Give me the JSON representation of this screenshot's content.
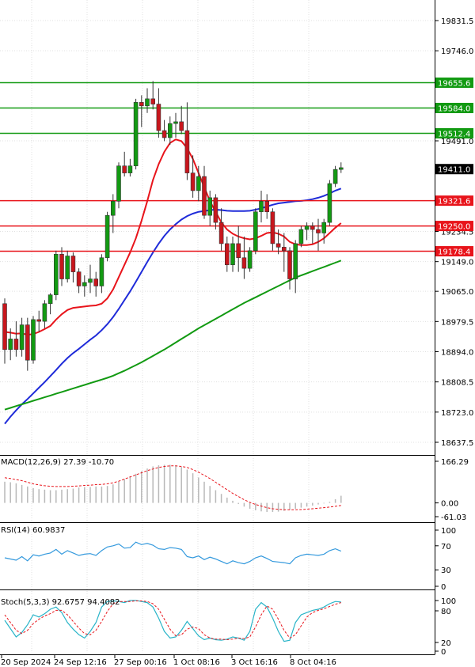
{
  "chart_data": {
    "type": "candlestick",
    "price_axis": {
      "ticks": [
        "19831.5",
        "19746.0",
        "19491.0",
        "19234.5",
        "19149.0",
        "19065.0",
        "18979.5",
        "18894.0",
        "18808.5",
        "18723.0",
        "18637.5"
      ],
      "tick_values": [
        19831.5,
        19746.0,
        19491.0,
        19234.5,
        19149.0,
        19065.0,
        18979.5,
        18894.0,
        18808.5,
        18723.0,
        18637.5
      ],
      "range": [
        18600,
        19900
      ]
    },
    "current_price": {
      "label": "19411.0",
      "value": 19411.0
    },
    "resistance_levels": [
      {
        "label": "19655.6",
        "value": 19655.6
      },
      {
        "label": "19584.0",
        "value": 19584.0
      },
      {
        "label": "19512.4",
        "value": 19512.4
      }
    ],
    "support_levels": [
      {
        "label": "19321.6",
        "value": 19321.6
      },
      {
        "label": "19250.0",
        "value": 19250.0
      },
      {
        "label": "19178.4",
        "value": 19178.4
      }
    ],
    "candles": [
      [
        19030,
        19045,
        18860,
        18900
      ],
      [
        18900,
        18960,
        18870,
        18930
      ],
      [
        18930,
        18980,
        18880,
        18900
      ],
      [
        18900,
        18990,
        18880,
        18970
      ],
      [
        18970,
        18990,
        18840,
        18870
      ],
      [
        18870,
        18995,
        18860,
        18985
      ],
      [
        18985,
        19010,
        18950,
        18980
      ],
      [
        18980,
        19040,
        18960,
        19030
      ],
      [
        19030,
        19060,
        19000,
        19055
      ],
      [
        19055,
        19180,
        19040,
        19170
      ],
      [
        19170,
        19190,
        19080,
        19100
      ],
      [
        19100,
        19180,
        19090,
        19165
      ],
      [
        19165,
        19175,
        19090,
        19120
      ],
      [
        19120,
        19130,
        19060,
        19080
      ],
      [
        19080,
        19110,
        19050,
        19090
      ],
      [
        19090,
        19140,
        19060,
        19100
      ],
      [
        19100,
        19120,
        19050,
        19080
      ],
      [
        19080,
        19170,
        19060,
        19160
      ],
      [
        19160,
        19290,
        19150,
        19280
      ],
      [
        19280,
        19340,
        19230,
        19320
      ],
      [
        19320,
        19430,
        19300,
        19420
      ],
      [
        19420,
        19460,
        19390,
        19400
      ],
      [
        19400,
        19440,
        19390,
        19420
      ],
      [
        19420,
        19610,
        19410,
        19600
      ],
      [
        19600,
        19620,
        19530,
        19590
      ],
      [
        19590,
        19640,
        19570,
        19610
      ],
      [
        19610,
        19660,
        19580,
        19595
      ],
      [
        19595,
        19640,
        19500,
        19520
      ],
      [
        19520,
        19550,
        19490,
        19500
      ],
      [
        19500,
        19560,
        19480,
        19540
      ],
      [
        19540,
        19570,
        19500,
        19545
      ],
      [
        19545,
        19590,
        19510,
        19520
      ],
      [
        19520,
        19600,
        19380,
        19400
      ],
      [
        19400,
        19450,
        19330,
        19350
      ],
      [
        19350,
        19420,
        19320,
        19390
      ],
      [
        19390,
        19420,
        19270,
        19280
      ],
      [
        19280,
        19350,
        19250,
        19330
      ],
      [
        19330,
        19340,
        19240,
        19260
      ],
      [
        19260,
        19300,
        19180,
        19200
      ],
      [
        19200,
        19220,
        19120,
        19140
      ],
      [
        19140,
        19220,
        19120,
        19200
      ],
      [
        19200,
        19250,
        19120,
        19160
      ],
      [
        19160,
        19220,
        19100,
        19130
      ],
      [
        19130,
        19190,
        19120,
        19180
      ],
      [
        19180,
        19300,
        19170,
        19290
      ],
      [
        19290,
        19350,
        19260,
        19320
      ],
      [
        19320,
        19340,
        19270,
        19290
      ],
      [
        19290,
        19300,
        19180,
        19200
      ],
      [
        19200,
        19240,
        19170,
        19190
      ],
      [
        19190,
        19230,
        19120,
        19180
      ],
      [
        19180,
        19190,
        19070,
        19100
      ],
      [
        19100,
        19210,
        19060,
        19200
      ],
      [
        19200,
        19250,
        19190,
        19240
      ],
      [
        19240,
        19260,
        19210,
        19250
      ],
      [
        19250,
        19260,
        19200,
        19240
      ],
      [
        19240,
        19270,
        19180,
        19230
      ],
      [
        19230,
        19270,
        19200,
        19260
      ],
      [
        19260,
        19380,
        19250,
        19370
      ],
      [
        19370,
        19420,
        19360,
        19410
      ],
      [
        19410,
        19430,
        19400,
        19415
      ]
    ],
    "moving_averages": [
      {
        "color": "#e8141b",
        "values": [
          18950,
          18948,
          18945,
          18946,
          18942,
          18944,
          18950,
          18958,
          18967,
          18985,
          19000,
          19012,
          19018,
          19020,
          19022,
          19024,
          19025,
          19030,
          19045,
          19070,
          19105,
          19140,
          19175,
          19215,
          19265,
          19320,
          19380,
          19425,
          19460,
          19485,
          19495,
          19490,
          19470,
          19440,
          19400,
          19360,
          19320,
          19290,
          19260,
          19240,
          19228,
          19220,
          19215,
          19212,
          19215,
          19222,
          19230,
          19232,
          19228,
          19220,
          19205,
          19198,
          19196,
          19196,
          19198,
          19205,
          19215,
          19230,
          19245,
          19258
        ]
      },
      {
        "color": "#1f2bd9",
        "values": [
          18690,
          18710,
          18728,
          18745,
          18760,
          18776,
          18792,
          18808,
          18825,
          18842,
          18860,
          18876,
          18890,
          18902,
          18915,
          18928,
          18940,
          18955,
          18972,
          18992,
          19015,
          19040,
          19065,
          19092,
          19120,
          19148,
          19175,
          19200,
          19222,
          19240,
          19255,
          19268,
          19278,
          19285,
          19290,
          19292,
          19295,
          19296,
          19295,
          19293,
          19292,
          19292,
          19292,
          19293,
          19296,
          19300,
          19305,
          19310,
          19314,
          19316,
          19318,
          19320,
          19321,
          19323,
          19326,
          19330,
          19335,
          19342,
          19350,
          19356
        ]
      },
      {
        "color": "#129a12",
        "values": [
          18730,
          18735,
          18740,
          18745,
          18750,
          18755,
          18760,
          18765,
          18770,
          18775,
          18780,
          18785,
          18790,
          18795,
          18800,
          18805,
          18810,
          18815,
          18820,
          18826,
          18833,
          18840,
          18848,
          18856,
          18864,
          18873,
          18882,
          18891,
          18900,
          18910,
          18920,
          18930,
          18940,
          18950,
          18960,
          18969,
          18978,
          18987,
          18996,
          19005,
          19014,
          19023,
          19032,
          19040,
          19048,
          19056,
          19064,
          19072,
          19080,
          19088,
          19096,
          19104,
          19110,
          19116,
          19122,
          19128,
          19134,
          19140,
          19146,
          19152
        ]
      }
    ],
    "x_axis": {
      "labels": [
        "20 Sep 2024",
        "24 Sep 12:16",
        "27 Sep 00:16",
        "1 Oct 08:16",
        "3 Oct 16:16",
        "8 Oct 04:16"
      ]
    },
    "macd": {
      "label": "MACD(12,26,9) 27.39 -10.70",
      "scale_labels": [
        "166.29",
        "0.00",
        "-61.03"
      ],
      "range": [
        -61.03,
        166.29
      ],
      "histogram": [
        80,
        78,
        74,
        68,
        62,
        56,
        52,
        50,
        48,
        48,
        50,
        52,
        54,
        58,
        60,
        60,
        62,
        62,
        64,
        70,
        80,
        90,
        100,
        110,
        120,
        130,
        138,
        142,
        144,
        144,
        142,
        136,
        126,
        112,
        96,
        80,
        64,
        48,
        34,
        20,
        8,
        -4,
        -14,
        -22,
        -28,
        -32,
        -34,
        -34,
        -33,
        -30,
        -26,
        -22,
        -18,
        -14,
        -10,
        -6,
        -2,
        4,
        14,
        27
      ],
      "signal": [
        95,
        92,
        88,
        84,
        78,
        72,
        68,
        65,
        63,
        62,
        62,
        62,
        63,
        64,
        66,
        67,
        69,
        70,
        72,
        76,
        82,
        90,
        98,
        106,
        114,
        122,
        128,
        134,
        138,
        140,
        140,
        138,
        134,
        126,
        116,
        104,
        92,
        78,
        64,
        50,
        36,
        24,
        12,
        2,
        -6,
        -12,
        -18,
        -22,
        -24,
        -26,
        -26,
        -26,
        -25,
        -24,
        -22,
        -20,
        -18,
        -16,
        -13,
        -10
      ]
    },
    "rsi": {
      "label": "RSI(14) 60.9837",
      "scale_labels": [
        "100",
        "70",
        "30",
        "0"
      ],
      "range": [
        0,
        100
      ],
      "values": [
        50,
        48,
        46,
        52,
        45,
        55,
        53,
        56,
        58,
        64,
        56,
        62,
        58,
        54,
        56,
        57,
        54,
        62,
        68,
        70,
        73,
        66,
        67,
        76,
        72,
        74,
        71,
        65,
        64,
        67,
        66,
        64,
        52,
        50,
        53,
        47,
        51,
        48,
        44,
        40,
        45,
        42,
        40,
        44,
        50,
        53,
        49,
        44,
        43,
        42,
        40,
        50,
        54,
        56,
        55,
        54,
        56,
        62,
        65,
        61
      ]
    },
    "stoch": {
      "label": "Stoch(5,3,3) 92.6757 94.4082",
      "scale_labels": [
        "100",
        "80",
        "20",
        "0"
      ],
      "range": [
        0,
        100
      ],
      "k": [
        60,
        45,
        30,
        38,
        52,
        70,
        66,
        72,
        80,
        84,
        74,
        56,
        44,
        34,
        28,
        40,
        56,
        84,
        94,
        95,
        94,
        92,
        96,
        96,
        94,
        92,
        84,
        64,
        40,
        28,
        30,
        42,
        58,
        45,
        32,
        25,
        28,
        25,
        24,
        26,
        30,
        28,
        24,
        40,
        80,
        92,
        84,
        64,
        40,
        22,
        24,
        56,
        70,
        74,
        78,
        80,
        84,
        90,
        94,
        93
      ],
      "d": [
        70,
        56,
        42,
        36,
        42,
        54,
        62,
        68,
        72,
        78,
        78,
        70,
        58,
        46,
        36,
        34,
        42,
        58,
        76,
        90,
        94,
        94,
        94,
        95,
        95,
        94,
        90,
        80,
        62,
        44,
        32,
        34,
        44,
        48,
        45,
        34,
        28,
        26,
        26,
        25,
        26,
        28,
        27,
        30,
        48,
        70,
        86,
        80,
        62,
        42,
        28,
        34,
        50,
        66,
        74,
        78,
        81,
        85,
        89,
        92
      ]
    }
  }
}
